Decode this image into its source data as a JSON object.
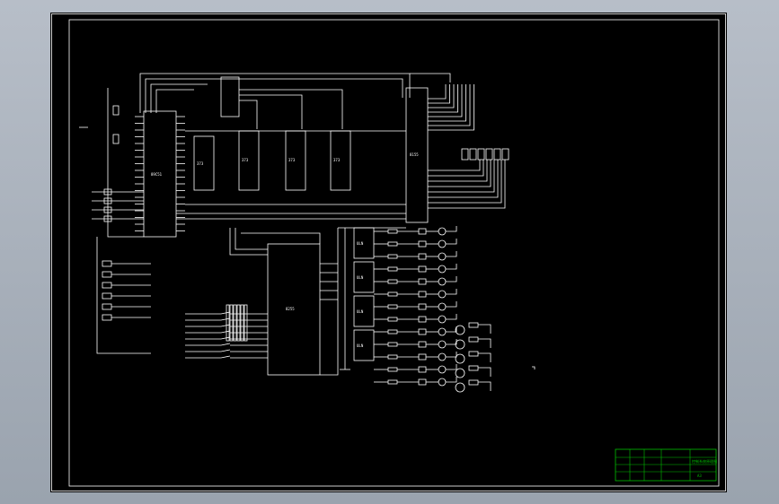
{
  "colors": {
    "viewport_bg": "#a6aeb9",
    "sheet": "#000000",
    "frame": "#ffffff",
    "wires": "#ffffff",
    "title_block": "#00c000"
  },
  "drawing": {
    "chips": [
      {
        "id": "mcu",
        "label": "89C51"
      },
      {
        "id": "latch1",
        "label": "373"
      },
      {
        "id": "latch2",
        "label": "373"
      },
      {
        "id": "latch3",
        "label": "373"
      },
      {
        "id": "latch4",
        "label": "373"
      },
      {
        "id": "display-driver",
        "label": "8155"
      },
      {
        "id": "main-controller",
        "label": "8255"
      },
      {
        "id": "relay-driver-1",
        "label": "ULN"
      },
      {
        "id": "relay-driver-2",
        "label": "ULN"
      },
      {
        "id": "relay-driver-3",
        "label": "ULN"
      },
      {
        "id": "relay-driver-4",
        "label": "ULN"
      }
    ],
    "title_block": {
      "drawing_name": "控制系统原理图",
      "code": "A3"
    }
  }
}
